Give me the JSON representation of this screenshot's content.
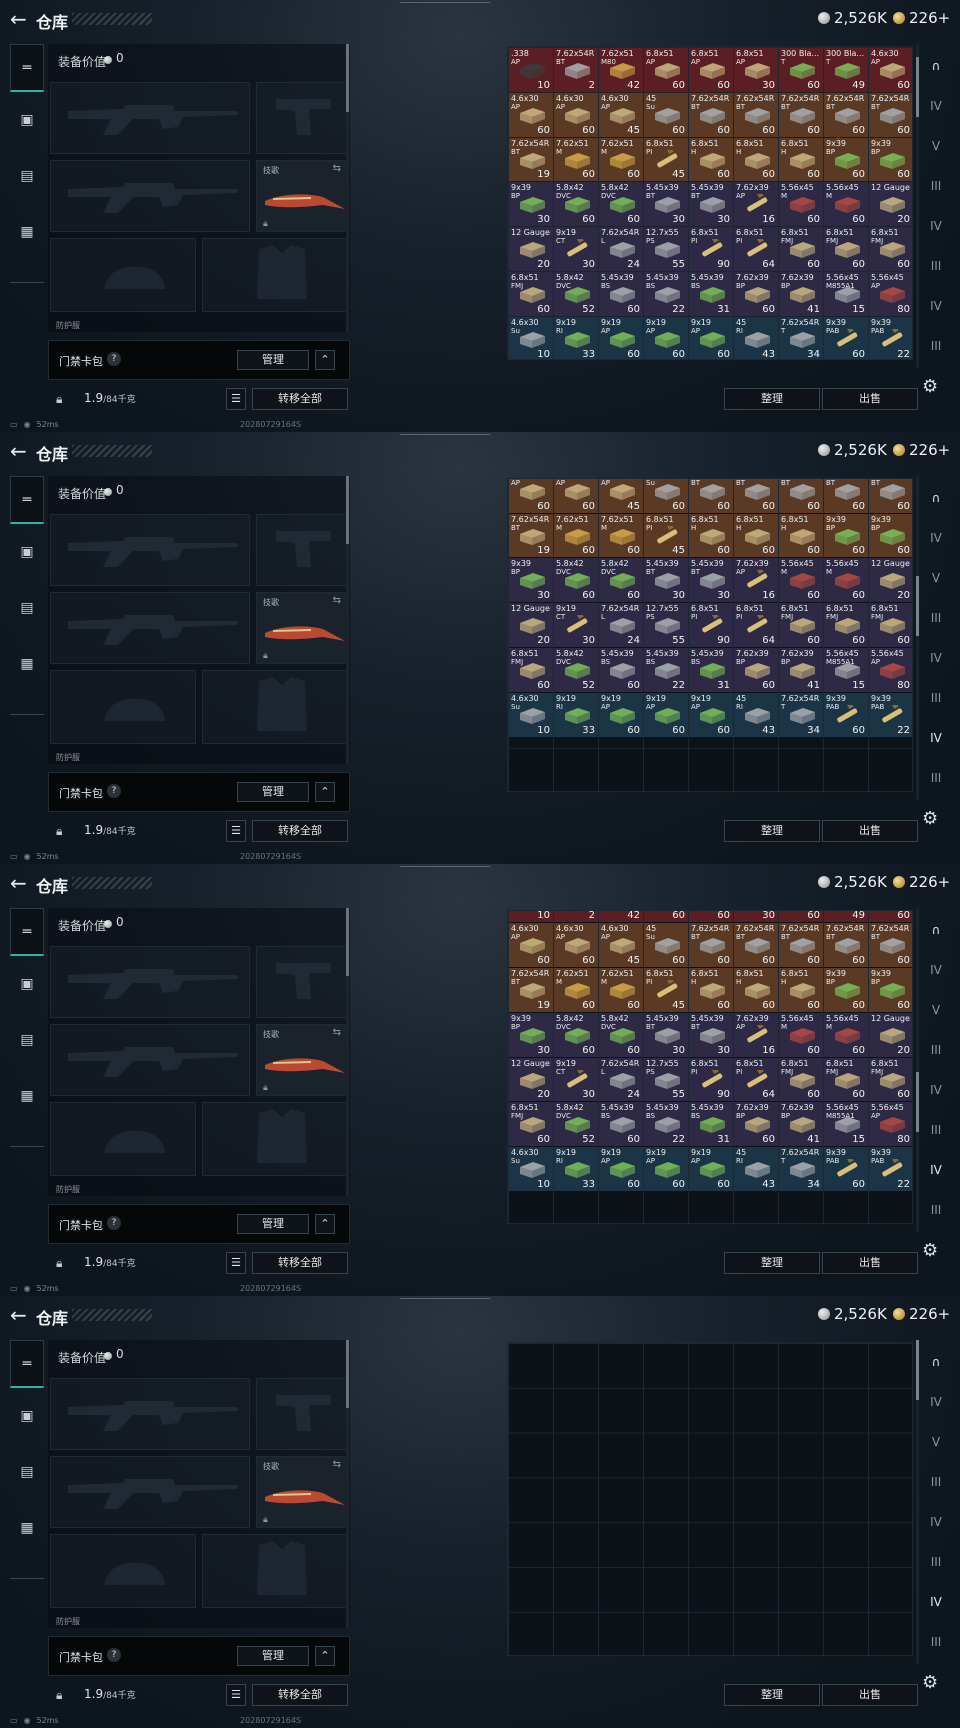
{
  "header": {
    "back_icon": "back-arrow-icon",
    "title": "仓库",
    "silver_amount": "2,526K",
    "gold_amount": "226+"
  },
  "loadout": {
    "value_label": "装备价值",
    "value": "0",
    "knife_label": "技歌",
    "small_text": "防护服",
    "keybag_label": "门禁卡包",
    "question": "?",
    "manage": "管理",
    "weight": "1.9",
    "weight_max": "/84千克",
    "transfer_all": "转移全部"
  },
  "status": {
    "ping": "52ms",
    "timestamp": "20280729164S"
  },
  "stash": {
    "sort": "整理",
    "sell": "出售"
  },
  "colors": {
    "accent": "#2fb2a3",
    "cell_red": "#5b1e22",
    "cell_orange": "#5b3a25",
    "cell_purple": "#2e2a45",
    "cell_blue": "#1b3547"
  },
  "rows": [
    {
      "bg": "red",
      "items": [
        {
          "n": ".338",
          "s": "AP",
          "c": "10",
          "a": "box-dark"
        },
        {
          "n": "7.62x54R",
          "s": "BT",
          "c": "2",
          "a": "box-gray"
        },
        {
          "n": "7.62x51",
          "s": "M80",
          "c": "42",
          "a": "box-gold"
        },
        {
          "n": "6.8x51",
          "s": "AP",
          "c": "60",
          "a": "box-tan"
        },
        {
          "n": "6.8x51",
          "s": "AP",
          "c": "60",
          "a": "box-tan"
        },
        {
          "n": "6.8x51",
          "s": "AP",
          "c": "30",
          "a": "box-tan"
        },
        {
          "n": "300 Bla...",
          "s": "T",
          "c": "60",
          "a": "box-green"
        },
        {
          "n": "300 Bla...",
          "s": "T",
          "c": "49",
          "a": "box-green"
        },
        {
          "n": "4.6x30",
          "s": "AP",
          "c": "60",
          "a": "box-tan"
        }
      ]
    },
    {
      "bg": "orange",
      "items": [
        {
          "n": "4.6x30",
          "s": "AP",
          "c": "60",
          "a": "box-tan"
        },
        {
          "n": "4.6x30",
          "s": "AP",
          "c": "60",
          "a": "box-tan"
        },
        {
          "n": "4.6x30",
          "s": "AP",
          "c": "45",
          "a": "box-tan"
        },
        {
          "n": "45",
          "s": "Su",
          "c": "60",
          "a": "box-gray"
        },
        {
          "n": "7.62x54R",
          "s": "BT",
          "c": "60",
          "a": "box-gray"
        },
        {
          "n": "7.62x54R",
          "s": "BT",
          "c": "60",
          "a": "box-gray"
        },
        {
          "n": "7.62x54R",
          "s": "BT",
          "c": "60",
          "a": "box-gray"
        },
        {
          "n": "7.62x54R",
          "s": "BT",
          "c": "60",
          "a": "box-gray"
        },
        {
          "n": "7.62x54R",
          "s": "BT",
          "c": "60",
          "a": "box-gray"
        }
      ]
    },
    {
      "bg": "orange",
      "items": [
        {
          "n": "7.62x54R",
          "s": "BT",
          "c": "19",
          "a": "box-tan"
        },
        {
          "n": "7.62x51",
          "s": "M",
          "c": "60",
          "a": "box-gold"
        },
        {
          "n": "7.62x51",
          "s": "M",
          "c": "60",
          "a": "box-gold"
        },
        {
          "n": "6.8x51",
          "s": "PI",
          "c": "45",
          "a": "round"
        },
        {
          "n": "6.8x51",
          "s": "H",
          "c": "60",
          "a": "box-tan"
        },
        {
          "n": "6.8x51",
          "s": "H",
          "c": "60",
          "a": "box-tan"
        },
        {
          "n": "6.8x51",
          "s": "H",
          "c": "60",
          "a": "box-tan"
        },
        {
          "n": "9x39",
          "s": "BP",
          "c": "60",
          "a": "box-green"
        },
        {
          "n": "9x39",
          "s": "BP",
          "c": "60",
          "a": "box-green"
        }
      ]
    },
    {
      "bg": "purple",
      "items": [
        {
          "n": "9x39",
          "s": "BP",
          "c": "30",
          "a": "box-green"
        },
        {
          "n": "5.8x42",
          "s": "DVC",
          "c": "60",
          "a": "box-green"
        },
        {
          "n": "5.8x42",
          "s": "DVC",
          "c": "60",
          "a": "box-green"
        },
        {
          "n": "5.45x39",
          "s": "BT",
          "c": "30",
          "a": "box-gray"
        },
        {
          "n": "5.45x39",
          "s": "BT",
          "c": "30",
          "a": "box-gray"
        },
        {
          "n": "7.62x39",
          "s": "AP",
          "c": "16",
          "a": "round"
        },
        {
          "n": "5.56x45",
          "s": "M",
          "c": "60",
          "a": "box-red"
        },
        {
          "n": "5.56x45",
          "s": "M",
          "c": "60",
          "a": "box-red"
        },
        {
          "n": "12 Gauge",
          "s": "",
          "c": "20",
          "a": "box-tan"
        }
      ]
    },
    {
      "bg": "purple",
      "items": [
        {
          "n": "12 Gauge",
          "s": "",
          "c": "20",
          "a": "box-tan"
        },
        {
          "n": "9x19",
          "s": "CT",
          "c": "30",
          "a": "round"
        },
        {
          "n": "7.62x54R",
          "s": "L",
          "c": "24",
          "a": "box-gray"
        },
        {
          "n": "12.7x55",
          "s": "PS",
          "c": "55",
          "a": "box-gray"
        },
        {
          "n": "6.8x51",
          "s": "PI",
          "c": "90",
          "a": "round"
        },
        {
          "n": "6.8x51",
          "s": "PI",
          "c": "64",
          "a": "round"
        },
        {
          "n": "6.8x51",
          "s": "FMJ",
          "c": "60",
          "a": "box-tan"
        },
        {
          "n": "6.8x51",
          "s": "FMJ",
          "c": "60",
          "a": "box-tan"
        },
        {
          "n": "6.8x51",
          "s": "FMJ",
          "c": "60",
          "a": "box-tan"
        }
      ]
    },
    {
      "bg": "purple",
      "items": [
        {
          "n": "6.8x51",
          "s": "FMJ",
          "c": "60",
          "a": "box-tan"
        },
        {
          "n": "5.8x42",
          "s": "DVC",
          "c": "52",
          "a": "box-green"
        },
        {
          "n": "5.45x39",
          "s": "BS",
          "c": "60",
          "a": "box-gray"
        },
        {
          "n": "5.45x39",
          "s": "BS",
          "c": "22",
          "a": "box-gray"
        },
        {
          "n": "5.45x39",
          "s": "BS",
          "c": "31",
          "a": "box-green"
        },
        {
          "n": "7.62x39",
          "s": "BP",
          "c": "60",
          "a": "box-tan"
        },
        {
          "n": "7.62x39",
          "s": "BP",
          "c": "41",
          "a": "box-tan"
        },
        {
          "n": "5.56x45",
          "s": "M855A1",
          "c": "15",
          "a": "box-gray"
        },
        {
          "n": "5.56x45",
          "s": "AP",
          "c": "80",
          "a": "box-red"
        }
      ]
    },
    {
      "bg": "blue",
      "items": [
        {
          "n": "4.6x30",
          "s": "Su",
          "c": "10",
          "a": "box-gray"
        },
        {
          "n": "9x19",
          "s": "RI",
          "c": "33",
          "a": "box-green"
        },
        {
          "n": "9x19",
          "s": "AP",
          "c": "60",
          "a": "box-green"
        },
        {
          "n": "9x19",
          "s": "AP",
          "c": "60",
          "a": "box-green"
        },
        {
          "n": "9x19",
          "s": "AP",
          "c": "60",
          "a": "box-green"
        },
        {
          "n": "45",
          "s": "RI",
          "c": "43",
          "a": "box-gray"
        },
        {
          "n": "7.62x54R",
          "s": "T",
          "c": "34",
          "a": "box-gray"
        },
        {
          "n": "9x39",
          "s": "PAB",
          "c": "60",
          "a": "round"
        },
        {
          "n": "9x39",
          "s": "PAB",
          "c": "22",
          "a": "round"
        }
      ]
    }
  ],
  "panels": [
    {
      "row_start": 0,
      "row_count": 7,
      "first_offset_fraction": 0,
      "scroll_fraction": 0.05
    },
    {
      "row_start": 1,
      "row_count": 6,
      "first_offset_fraction": -0.25,
      "scroll_fraction": 0.38
    },
    {
      "row_start": 0,
      "row_count": 7,
      "first_offset_fraction": -0.75,
      "scroll_fraction": 0.62
    },
    {
      "row_start": 0,
      "row_count": 0,
      "first_offset_fraction": 0,
      "scroll_fraction": 0.0
    }
  ],
  "right_nav": [
    {
      "icon": "helmet-icon",
      "label": ""
    },
    {
      "icon": "tier4-box-icon",
      "label": "IV"
    },
    {
      "icon": "tier5-box-icon",
      "label": "V"
    },
    {
      "icon": "tier3-box-icon",
      "label": "III"
    },
    {
      "icon": "tier4-alt-icon",
      "label": "IV"
    },
    {
      "icon": "tier3-case-icon",
      "label": "III"
    },
    {
      "icon": "tier4-case-icon",
      "label": "IV"
    },
    {
      "icon": "tier3-ext-icon",
      "label": "III"
    }
  ]
}
